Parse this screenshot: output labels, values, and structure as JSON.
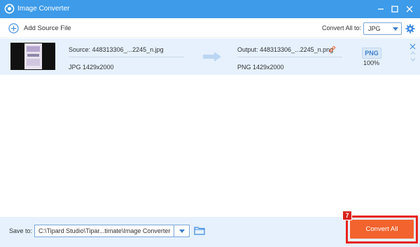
{
  "window": {
    "title": "Image Converter",
    "title_bar_color": "#3d9be9"
  },
  "toolbar": {
    "add_source_label": "Add Source File",
    "convert_all_to_label": "Convert All to:",
    "convert_all_format": "JPG"
  },
  "files": [
    {
      "source_name": "Source: 448313306_...2245_n.jpg",
      "source_format": "JPG",
      "source_resolution": "1429x2000",
      "output_name": "Output: 448313306_...2245_n.png",
      "output_format": "PNG",
      "output_resolution": "1429x2000",
      "format_badge": "PNG",
      "quality": "100%"
    }
  ],
  "footer": {
    "save_to_label": "Save to:",
    "save_path": "C:\\Tipard Studio\\Tipar...timate\\Image Converter",
    "convert_all_button": "Convert All",
    "step_badge": "7",
    "accent_color": "#f2632e",
    "highlight_color": "#e8231c"
  }
}
